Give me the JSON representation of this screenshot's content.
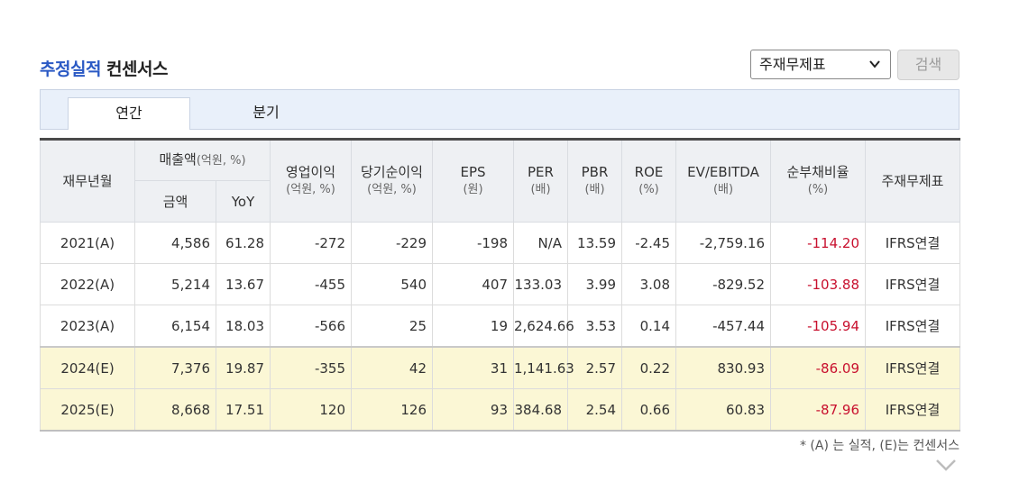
{
  "header": {
    "title_main": "추정실적",
    "title_sub": "컨센서스",
    "select_value": "주재무제표",
    "search_label": "검색"
  },
  "tabs": [
    {
      "label": "연간",
      "active": true
    },
    {
      "label": "분기",
      "active": false
    }
  ],
  "table": {
    "headers": {
      "period": "재무년월",
      "sales": "매출액",
      "sales_unit": "(억원, %)",
      "sales_amount": "금액",
      "sales_yoy": "YoY",
      "op_income": "영업이익",
      "op_income_unit": "(억원, %)",
      "net_income": "당기순이익",
      "net_income_unit": "(억원, %)",
      "eps": "EPS",
      "eps_unit": "(원)",
      "per": "PER",
      "per_unit": "(배)",
      "pbr": "PBR",
      "pbr_unit": "(배)",
      "roe": "ROE",
      "roe_unit": "(%)",
      "ev_ebitda": "EV/EBITDA",
      "ev_ebitda_unit": "(배)",
      "debt_ratio": "순부채비율",
      "debt_ratio_unit": "(%)",
      "statement": "주재무제표"
    },
    "rows": [
      {
        "period": "2021(A)",
        "sales": "4,586",
        "yoy": "61.28",
        "op": "-272",
        "net": "-229",
        "eps": "-198",
        "per": "N/A",
        "pbr": "13.59",
        "roe": "-2.45",
        "ev": "-2,759.16",
        "debt": "-114.20",
        "std": "IFRS연결"
      },
      {
        "period": "2022(A)",
        "sales": "5,214",
        "yoy": "13.67",
        "op": "-455",
        "net": "540",
        "eps": "407",
        "per": "133.03",
        "pbr": "3.99",
        "roe": "3.08",
        "ev": "-829.52",
        "debt": "-103.88",
        "std": "IFRS연결"
      },
      {
        "period": "2023(A)",
        "sales": "6,154",
        "yoy": "18.03",
        "op": "-566",
        "net": "25",
        "eps": "19",
        "per": "2,624.66",
        "pbr": "3.53",
        "roe": "0.14",
        "ev": "-457.44",
        "debt": "-105.94",
        "std": "IFRS연결"
      },
      {
        "period": "2024(E)",
        "sales": "7,376",
        "yoy": "19.87",
        "op": "-355",
        "net": "42",
        "eps": "31",
        "per": "1,141.63",
        "pbr": "2.57",
        "roe": "0.22",
        "ev": "830.93",
        "debt": "-86.09",
        "std": "IFRS연결"
      },
      {
        "period": "2025(E)",
        "sales": "8,668",
        "yoy": "17.51",
        "op": "120",
        "net": "126",
        "eps": "93",
        "per": "384.68",
        "pbr": "2.54",
        "roe": "0.66",
        "ev": "60.83",
        "debt": "-87.96",
        "std": "IFRS연결"
      }
    ]
  },
  "footnote": "* (A) 는 실적, (E)는 컨센서스",
  "colors": {
    "title_blue": "#2a59c4",
    "negative_red": "#c8102e",
    "estimate_row_bg": "#fbf7d5",
    "tab_bar_bg": "#e9f0fa"
  }
}
